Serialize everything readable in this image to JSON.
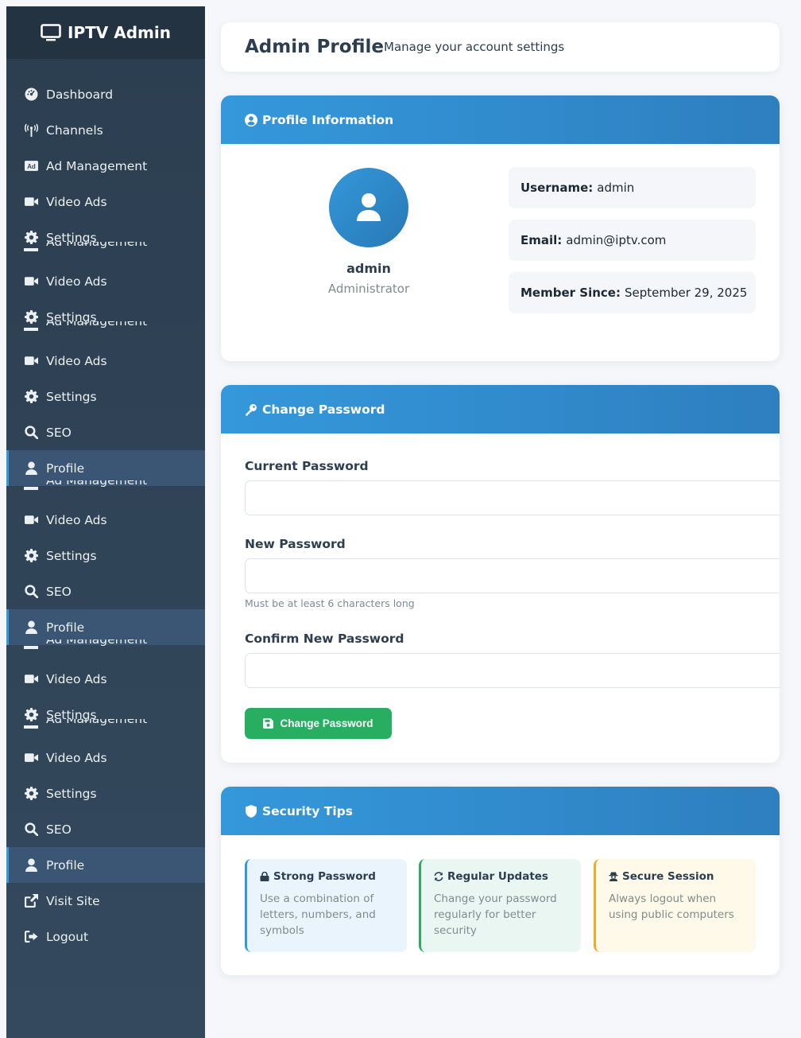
{
  "brand": {
    "title": "IPTV Admin"
  },
  "nav": {
    "items": [
      {
        "label": "Dashboard",
        "icon": "dashboard-icon"
      },
      {
        "label": "Channels",
        "icon": "broadcast-icon"
      },
      {
        "label": "Ad Management",
        "icon": "ad-icon"
      },
      {
        "label": "Video Ads",
        "icon": "video-icon"
      },
      {
        "label": "Settings",
        "icon": "gear-icon"
      },
      {
        "label": "Video Ads",
        "icon": "video-icon"
      },
      {
        "label": "Settings",
        "icon": "gear-icon"
      },
      {
        "label": "Video Ads",
        "icon": "video-icon"
      },
      {
        "label": "Settings",
        "icon": "gear-icon"
      },
      {
        "label": "SEO",
        "icon": "search-icon"
      },
      {
        "label": "Profile",
        "icon": "user-icon",
        "active": true
      },
      {
        "label": "Video Ads",
        "icon": "video-icon"
      },
      {
        "label": "Settings",
        "icon": "gear-icon"
      },
      {
        "label": "SEO",
        "icon": "search-icon"
      },
      {
        "label": "Profile",
        "icon": "user-icon",
        "active": true
      },
      {
        "label": "Video Ads",
        "icon": "video-icon"
      },
      {
        "label": "Settings",
        "icon": "gear-icon"
      },
      {
        "label": "Video Ads",
        "icon": "video-icon"
      },
      {
        "label": "Settings",
        "icon": "gear-icon"
      },
      {
        "label": "SEO",
        "icon": "search-icon"
      },
      {
        "label": "Profile",
        "icon": "user-icon",
        "active": true
      },
      {
        "label": "Visit Site",
        "icon": "external-link-icon"
      },
      {
        "label": "Logout",
        "icon": "logout-icon"
      }
    ],
    "ghost_label": "Ad Management"
  },
  "header": {
    "title": "Admin Profile",
    "subtitle": "Manage your account settings"
  },
  "profile_card": {
    "heading": "Profile Information",
    "name": "admin",
    "role": "Administrator",
    "username_label": "Username:",
    "username": "admin",
    "email_label": "Email:",
    "email": "admin@iptv.com",
    "member_label": "Member Since:",
    "member_since": "September 29, 2025"
  },
  "password_card": {
    "heading": "Change Password",
    "current_label": "Current Password",
    "current_value": "",
    "new_label": "New Password",
    "new_value": "",
    "new_hint": "Must be at least 6 characters long",
    "confirm_label": "Confirm New Password",
    "confirm_value": "",
    "submit_label": "Change Password"
  },
  "tips_card": {
    "heading": "Security Tips",
    "tips": [
      {
        "title": "Strong Password",
        "text": "Use a combination of letters, numbers, and symbols",
        "icon": "lock-icon",
        "bg": "#eaf4fd",
        "accent": "#3498db"
      },
      {
        "title": "Regular Updates",
        "text": "Change your password regularly for better security",
        "icon": "refresh-icon",
        "bg": "#e9f6f1",
        "accent": "#27ae60"
      },
      {
        "title": "Secure Session",
        "text": "Always logout when using public computers",
        "icon": "user-secret-icon",
        "bg": "#fef9e8",
        "accent": "#f0a92b"
      }
    ]
  },
  "colors": {
    "sidebar": "#2c3e50",
    "accent": "#3498db",
    "success": "#27ae60"
  }
}
